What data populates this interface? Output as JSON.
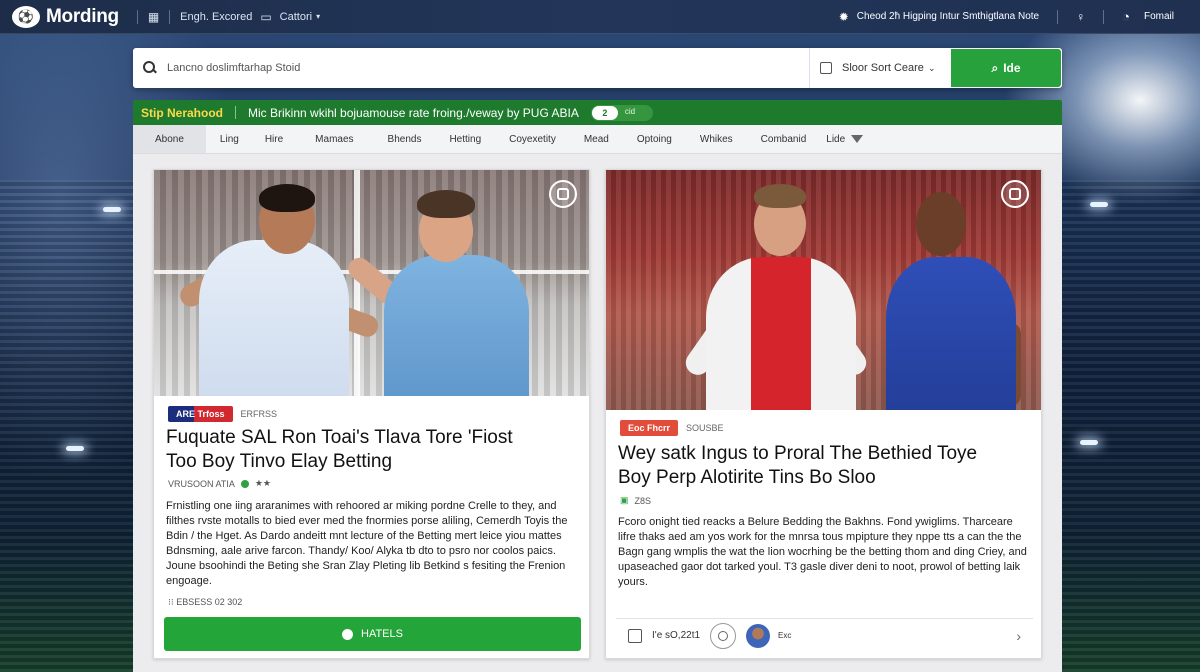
{
  "topbar": {
    "logo_text": "Mording",
    "nav_item_1": "Engh. Excored",
    "nav_item_2": "Cattori",
    "right_text": "Cheod 2ħ Higping Intur Smthigtlana Note",
    "format_label": "Fomail"
  },
  "search": {
    "placeholder": "Lancno doslimftarhap Stoid",
    "sort_label": "Sloor Sort Ceare",
    "button_label": "Ide"
  },
  "ticker": {
    "label": "Stip Nerahood",
    "text": "Mic Brikinn wkihl bojuamouse rate froing./veway by PUG ABIA",
    "toggle_value": "2",
    "toggle_label": "cid"
  },
  "tabs": [
    "Abone",
    "Ling",
    "Hire",
    "Mamaes",
    "Bhends",
    "Hetting",
    "Coyexetity",
    "Mead",
    "Optoing",
    "Whikes",
    "Combanid",
    "Lide"
  ],
  "card1": {
    "tag": "ARE Trfoss",
    "tag_meta": "ERFRSS",
    "headline_1": "Fuquate SAL Ron Toai's Tlava Tore 'Fiost",
    "headline_2": "Too Boy Tinvo Elay Betting",
    "meta": "VRUSOON ATIA",
    "body": "Frnistling one iing araranimes with rehoored ar miking pordne Crelle to they, and filthes rvste motalls to bied ever med the fnormies porse aliling, Cemerdh Toyis the Bdin / the Hget. As Dardo andeitt mnt lecture of the Betting mert leice yiou mattes Bdnsming, aale arive farcon. Thandy/ Koo/ Alyka tb dto to psro nor coolos paics. Joune bsoohindi the Beting she Sran Zlay Pleting lib Betkind s fesiting the Frenion engoage.",
    "byline": "EBSESS 02 302",
    "cta": "HATELS"
  },
  "card2": {
    "tag": "Eoc Fhcrr",
    "tag_meta": "SOUSBE",
    "headline_1": "Wey satk Ingus to Proral The Bethied Toye",
    "headline_2": "Boy Perp Alotirite Tins Bo Sloo",
    "meta": "Z8S",
    "body": "Fcoro onight tied reacks a Belure Bedding the Bakhns. Fond ywiglims. Tharceare lifre thaks aed am yos work for the mnrsa tous mpipture they nppe tts a can the the Bagn gang wmplis the wat the lion wocrhing be the betting thom and ding Criey, and upaseached gaor dot tarked youl. T3 gasle diver deni to noot, prowol of betting laik yours.",
    "footer_text": "I'e sO,22t1",
    "footer_small": "Exc"
  }
}
